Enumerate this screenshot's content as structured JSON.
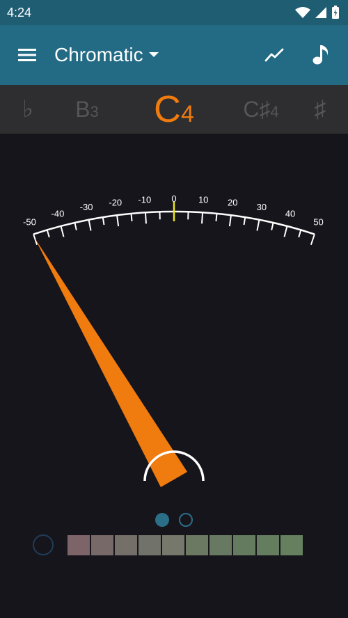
{
  "status_bar": {
    "time": "4:24"
  },
  "app_bar": {
    "title": "Chromatic"
  },
  "note_strip": {
    "flat_symbol": "♭",
    "sharp_symbol": "♯",
    "previous": {
      "letter": "B",
      "octave": "3"
    },
    "current": {
      "letter": "C",
      "octave": "4"
    },
    "next": {
      "letter": "C♯",
      "octave": "4"
    }
  },
  "gauge": {
    "scale_labels": [
      "-50",
      "-40",
      "-30",
      "-20",
      "-10",
      "0",
      "10",
      "20",
      "30",
      "40",
      "50"
    ],
    "cents_reading": -50
  },
  "pager": {
    "page_count": 2,
    "active_page": 1
  },
  "history_colors": [
    "#7d6469",
    "#776967",
    "#746f68",
    "#71736a",
    "#75786a",
    "#6b7862",
    "#677a61",
    "#647b5f",
    "#637d5e",
    "#657f5f"
  ],
  "colors": {
    "accent": "#f07b0e",
    "app_bar": "#236b84",
    "status_bar": "#1f5d73",
    "note_strip": "#2e2e30",
    "background": "#17151c",
    "center_mark": "#e6e61c",
    "inactive_note": "#55555a"
  }
}
